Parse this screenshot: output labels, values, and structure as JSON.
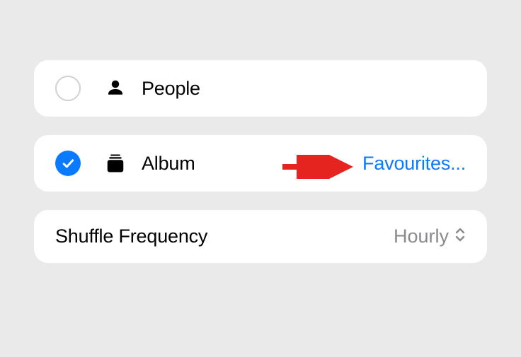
{
  "options": {
    "people": {
      "label": "People",
      "selected": false
    },
    "album": {
      "label": "Album",
      "selected": true,
      "value": "Favourites..."
    }
  },
  "shuffle": {
    "label": "Shuffle Frequency",
    "value": "Hourly"
  }
}
